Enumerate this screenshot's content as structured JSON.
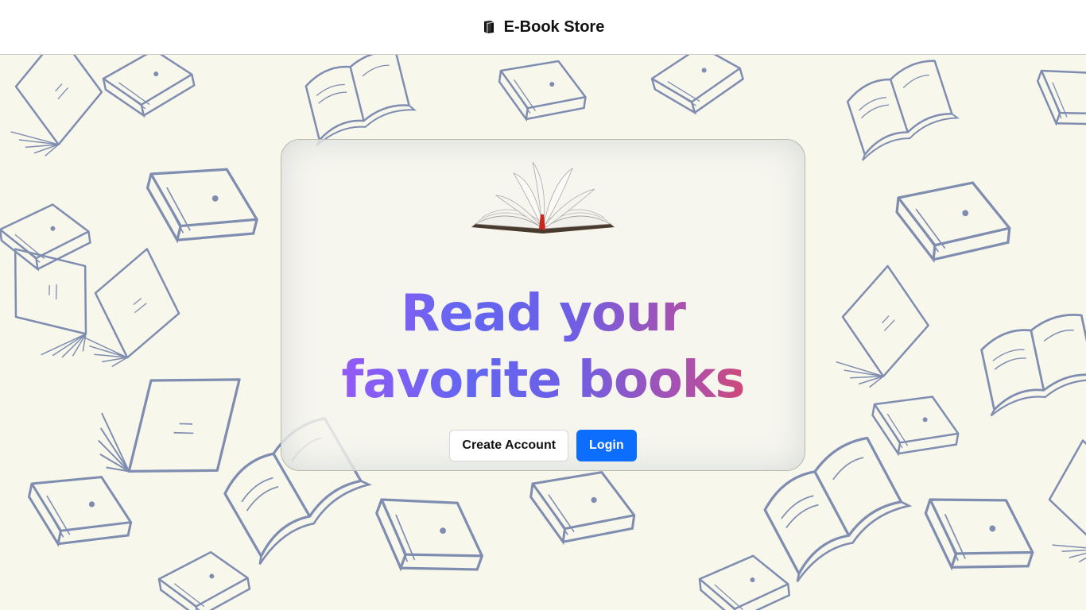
{
  "navbar": {
    "brand_label": "E-Book Store",
    "brand_icon": "book-icon"
  },
  "hero": {
    "image_icon": "open-book-image",
    "headline": "Read your favorite books",
    "create_account_label": "Create Account",
    "login_label": "Login"
  },
  "colors": {
    "background": "#f8f7ec",
    "pattern_stroke": "#7f8db0",
    "primary_button": "#0d6efd",
    "gradient_start": "#a855f7",
    "gradient_mid": "#6366f1",
    "gradient_end": "#ef4444"
  }
}
